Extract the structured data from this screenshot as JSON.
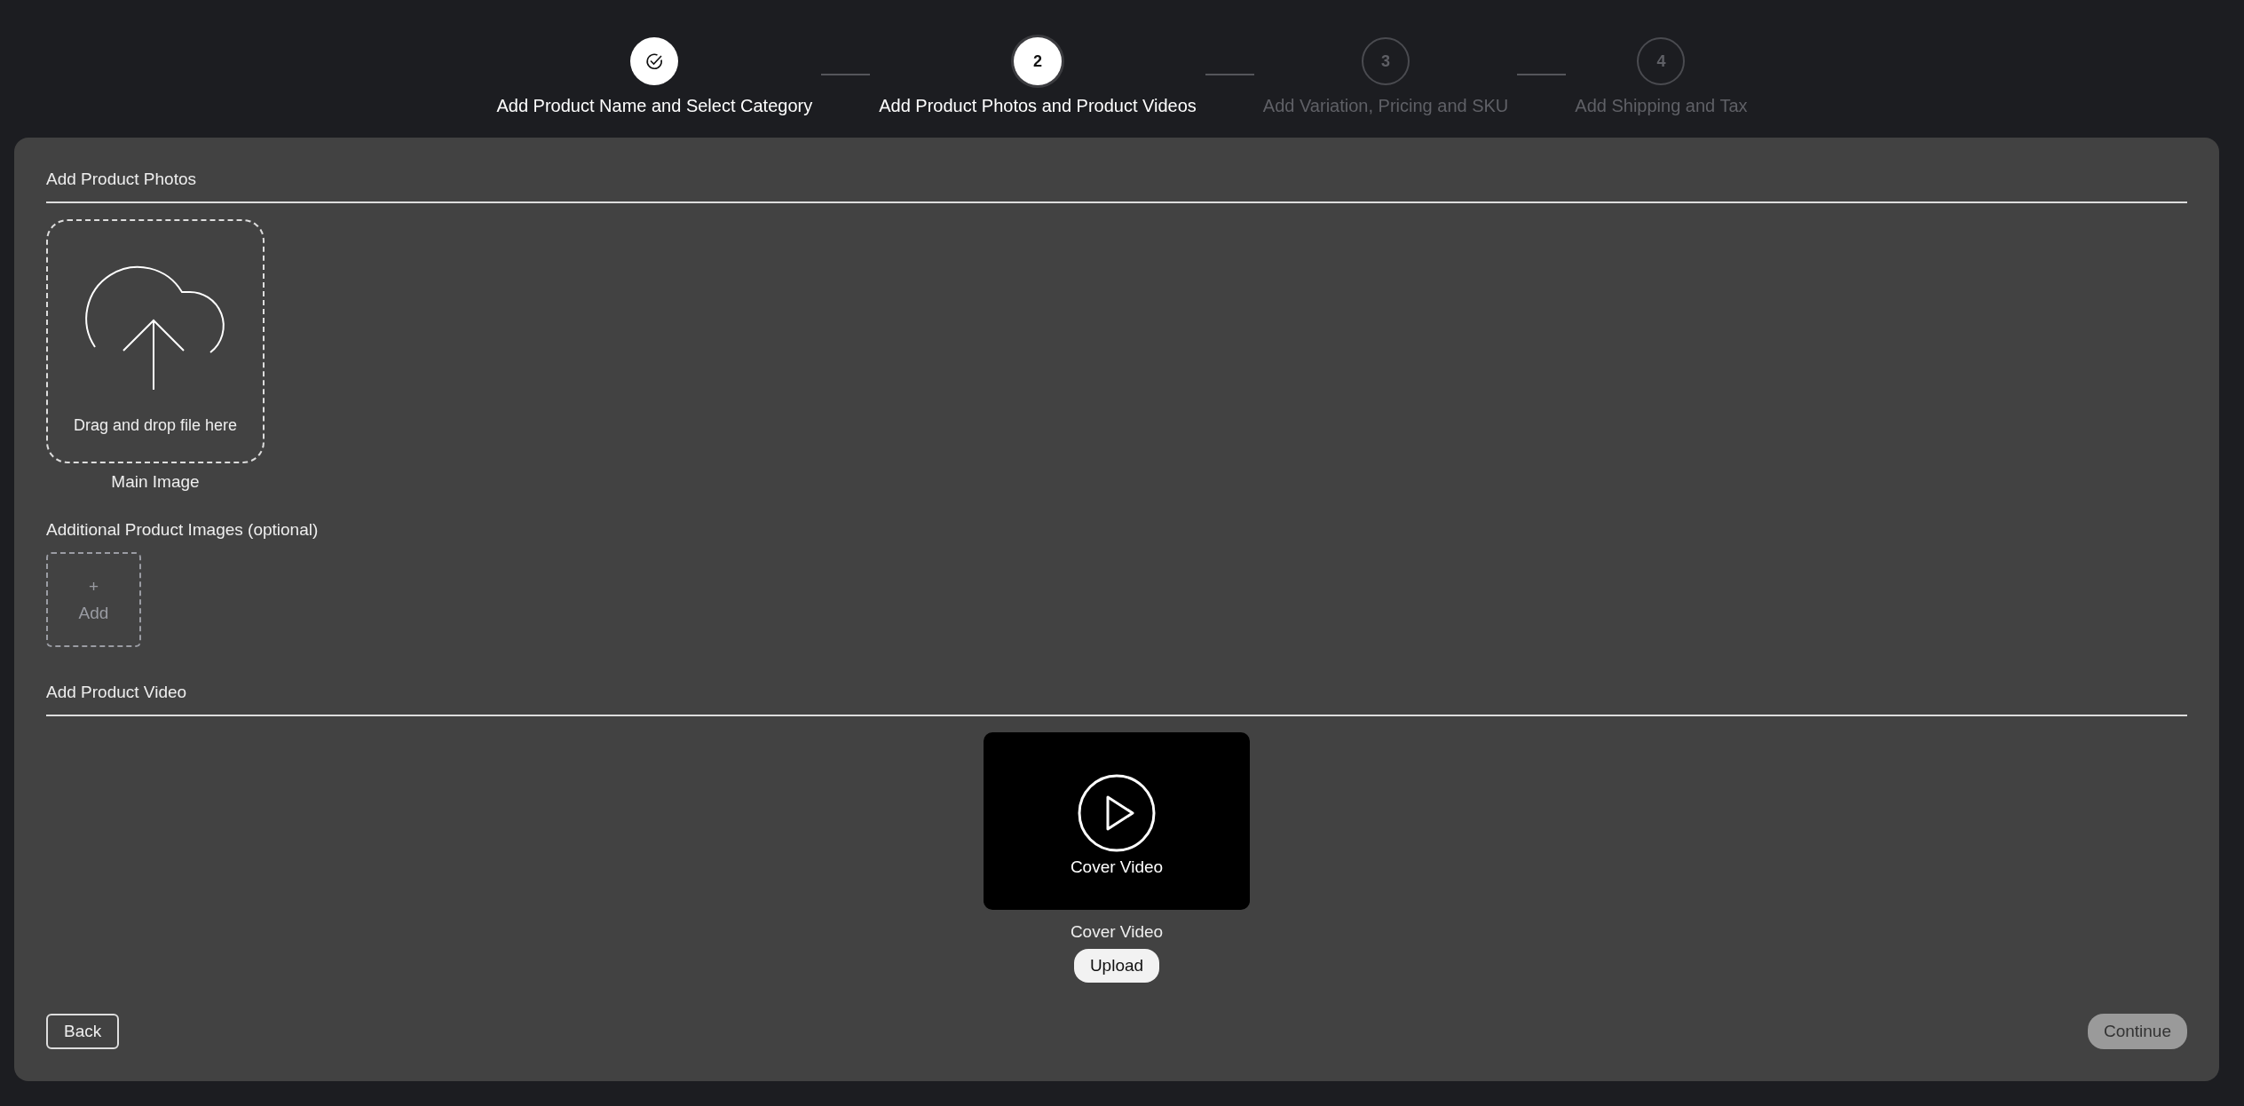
{
  "stepper": {
    "steps": [
      {
        "label": "Add Product Name and Select Category",
        "completed": true,
        "selected": false
      },
      {
        "label": "Add Product Photos and Product Videos",
        "number": "2",
        "completed": false,
        "selected": true
      },
      {
        "label": "Add Variation, Pricing and SKU",
        "number": "3",
        "completed": false,
        "selected": false
      },
      {
        "label": "Add Shipping and Tax",
        "number": "4",
        "completed": false,
        "selected": false
      }
    ]
  },
  "photos": {
    "heading": "Add Product Photos",
    "dropzone": {
      "hint": "Drag and drop file here"
    },
    "main_label": "Main Image",
    "additional_heading": "Additional Product Images (optional)",
    "add_tile": {
      "symbol": "+",
      "label": "Add"
    }
  },
  "video": {
    "heading": "Add Product Video",
    "preview_caption": "Cover Video",
    "label": "Cover Video",
    "upload_button": "Upload"
  },
  "footer": {
    "back_button": "Back",
    "continue_button": {
      "label": "Continue",
      "disabled": true
    }
  }
}
